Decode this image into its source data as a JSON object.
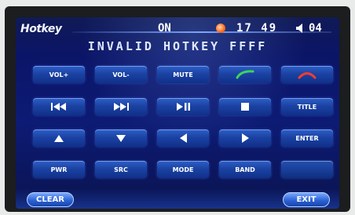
{
  "header": {
    "title": "Hotkey",
    "mode": "ON",
    "time": "17 49",
    "volume": "04",
    "speaker_icon": "speaker-icon",
    "indicator_color": "#ff6a1a"
  },
  "status_text": "INVALID HOTKEY  FFFF",
  "rows": [
    [
      {
        "type": "text",
        "label": "VOL+"
      },
      {
        "type": "text",
        "label": "VOL-"
      },
      {
        "type": "text",
        "label": "MUTE"
      },
      {
        "type": "icon",
        "icon": "phone-answer-icon",
        "color": "#3fd25a"
      },
      {
        "type": "icon",
        "icon": "phone-hangup-icon",
        "color": "#ff3a2e"
      }
    ],
    [
      {
        "type": "icon",
        "icon": "previous-track-icon"
      },
      {
        "type": "icon",
        "icon": "next-track-icon"
      },
      {
        "type": "icon",
        "icon": "play-pause-icon"
      },
      {
        "type": "icon",
        "icon": "stop-icon"
      },
      {
        "type": "text",
        "label": "TITLE"
      }
    ],
    [
      {
        "type": "icon",
        "icon": "arrow-up-icon"
      },
      {
        "type": "icon",
        "icon": "arrow-down-icon"
      },
      {
        "type": "icon",
        "icon": "arrow-left-icon"
      },
      {
        "type": "icon",
        "icon": "arrow-right-icon"
      },
      {
        "type": "text",
        "label": "ENTER"
      }
    ],
    [
      {
        "type": "text",
        "label": "PWR"
      },
      {
        "type": "text",
        "label": "SRC"
      },
      {
        "type": "text",
        "label": "MODE"
      },
      {
        "type": "text",
        "label": "BAND"
      },
      {
        "type": "blank"
      }
    ]
  ],
  "footer": {
    "clear_label": "CLEAR",
    "exit_label": "EXIT"
  }
}
